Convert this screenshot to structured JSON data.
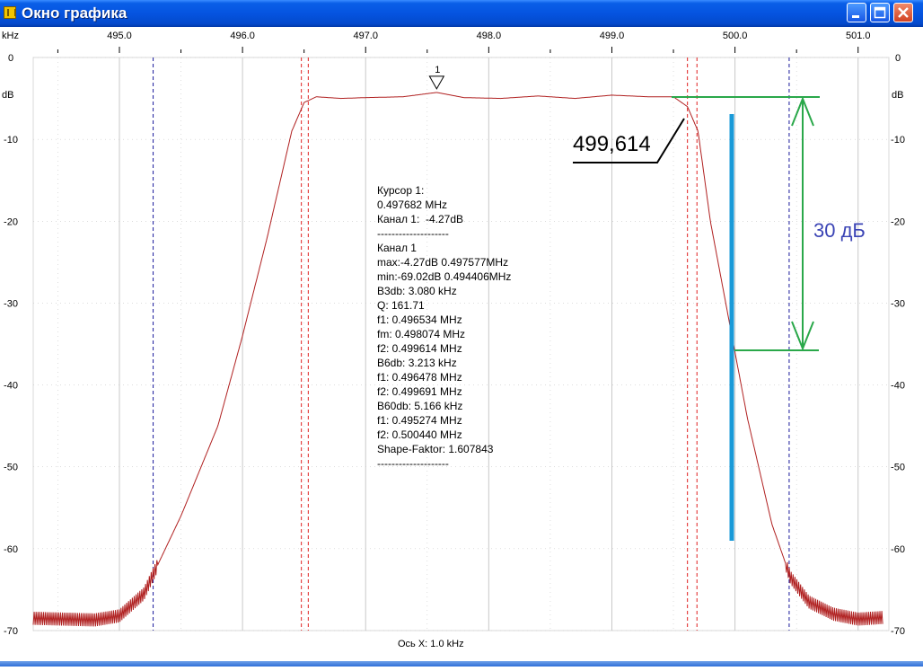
{
  "window": {
    "title": "Окно графика",
    "buttons": [
      "minimize",
      "maximize",
      "close"
    ]
  },
  "axes": {
    "x_unit": "kHz",
    "y_unit": "dB",
    "x_ticks": [
      "495.0",
      "496.0",
      "497.0",
      "498.0",
      "499.0",
      "500.0",
      "501.0"
    ],
    "y_ticks": [
      "0",
      "-10",
      "-20",
      "-30",
      "-40",
      "-50",
      "-60",
      "-70"
    ],
    "x_caption": "Ось X: 1.0 kHz"
  },
  "marker": {
    "label": "1"
  },
  "info_lines": [
    "Курсор 1:",
    "0.497682 MHz",
    "Канал 1:  -4.27dB",
    "--------------------",
    "Канал 1",
    "max:-4.27dB 0.497577MHz",
    "min:-69.02dB 0.494406MHz",
    "B3db: 3.080 kHz",
    "Q: 161.71",
    "f1: 0.496534 MHz",
    "fm: 0.498074 MHz",
    "f2: 0.499614 MHz",
    "B6db: 3.213 kHz",
    "f1: 0.496478 MHz",
    "f2: 0.499691 MHz",
    "B60db: 5.166 kHz",
    "f1: 0.495274 MHz",
    "f2: 0.500440 MHz",
    "Shape-Faktor: 1.607843",
    "--------------------"
  ],
  "annotations": {
    "freq_label": "499,614",
    "attenuation_label": "30 дБ"
  },
  "colors": {
    "trace": "#b02020",
    "red_markers": "#e02020",
    "blue_markers": "#1a1a9a",
    "green_annotation": "#2aa84a",
    "cyan_annotation": "#1a9ad8",
    "grid": "#c8c8c8"
  },
  "chart_data": {
    "type": "line",
    "xlabel": "kHz",
    "ylabel": "dB",
    "xlim": [
      494.3,
      501.25
    ],
    "ylim": [
      -70,
      0
    ],
    "x": [
      494.3,
      494.8,
      495.0,
      495.2,
      495.5,
      495.8,
      496.0,
      496.2,
      496.4,
      496.5,
      496.6,
      496.8,
      497.0,
      497.3,
      497.577,
      497.8,
      498.1,
      498.4,
      498.7,
      499.0,
      499.3,
      499.5,
      499.614,
      499.7,
      499.8,
      499.95,
      500.1,
      500.3,
      500.45,
      500.6,
      500.8,
      501.0,
      501.2
    ],
    "series": [
      {
        "values": [
          -68.5,
          -68.7,
          -68.2,
          -65.5,
          -56,
          -45,
          -34,
          -22,
          -9,
          -5.5,
          -4.8,
          -5.0,
          -4.9,
          -4.8,
          -4.27,
          -4.9,
          -5.0,
          -4.7,
          -5.0,
          -4.6,
          -4.8,
          -4.8,
          -6.0,
          -9.0,
          -20,
          -32,
          -44,
          -57,
          -63.5,
          -66.5,
          -68,
          -68.6,
          -68.4
        ]
      }
    ],
    "reference_lines": {
      "red_dashed_x": [
        496.478,
        496.534,
        499.614,
        499.691
      ],
      "blue_dashed_x": [
        495.274,
        500.44
      ]
    }
  }
}
